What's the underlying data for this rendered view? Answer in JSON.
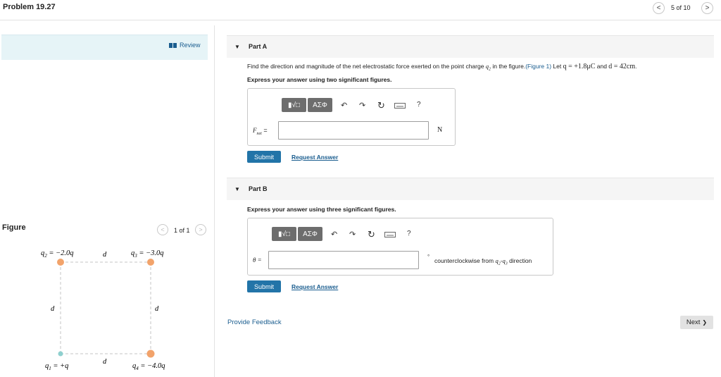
{
  "header": {
    "title": "Problem 19.27",
    "counter": "5 of 10",
    "prev_glyph": "<",
    "next_glyph": ">"
  },
  "left": {
    "review_label": "Review",
    "figure_label": "Figure",
    "figure_counter": "1 of 1",
    "fig_prev_glyph": "<",
    "fig_next_glyph": ">",
    "figure": {
      "q2_label": "q",
      "q2_sub": "2",
      "q2_value": " = −2.0q",
      "q3_label": "q",
      "q3_sub": "3",
      "q3_value": " = −3.0q",
      "q1_label": "q",
      "q1_sub": "1",
      "q1_value": " = +q",
      "q4_label": "q",
      "q4_sub": "4",
      "q4_value": " = −4.0q",
      "d": "d"
    }
  },
  "partA": {
    "caret": "▼",
    "title": "Part A",
    "instruction_1": "Find the direction and magnitude of the net electrostatic force exerted on the point charge ",
    "instruction_q2": "q",
    "instruction_q2_sub": "2",
    "instruction_2": " in the figure.",
    "figure_link": "(Figure 1)",
    "instruction_3": " Let ",
    "let_q": "q = +1.8μC",
    "instruction_and": " and ",
    "let_d": "d = 42cm",
    "instruction_end": ".",
    "express": "Express your answer using two significant figures.",
    "tool_sqrt": "▮√□",
    "tool_greek": "ΑΣΦ",
    "tool_help": "?",
    "var_label": "F",
    "var_sub": "net",
    "var_eq": " =",
    "input_value": "",
    "unit": "N",
    "submit": "Submit",
    "request": "Request Answer"
  },
  "partB": {
    "caret": "▼",
    "title": "Part B",
    "express": "Express your answer using three significant figures.",
    "tool_sqrt": "▮√□",
    "tool_greek": "ΑΣΦ",
    "tool_help": "?",
    "var_label": "θ =",
    "input_value": "",
    "degree": "°",
    "direction_1": "counterclockwise from ",
    "direction_q": "q",
    "direction_q_sub": "2",
    "direction_dash": "-",
    "direction_q2": "q",
    "direction_q2_sub": "3",
    "direction_2": " direction",
    "submit": "Submit",
    "request": "Request Answer"
  },
  "footer": {
    "feedback": "Provide Feedback",
    "next": "Next",
    "next_glyph": "❯"
  },
  "colors": {
    "accent": "#2274a8",
    "link": "#1a5d8f",
    "review_bg": "#e6f4f7",
    "charge_orange": "#f2a36b",
    "charge_teal": "#8fd0cf"
  }
}
